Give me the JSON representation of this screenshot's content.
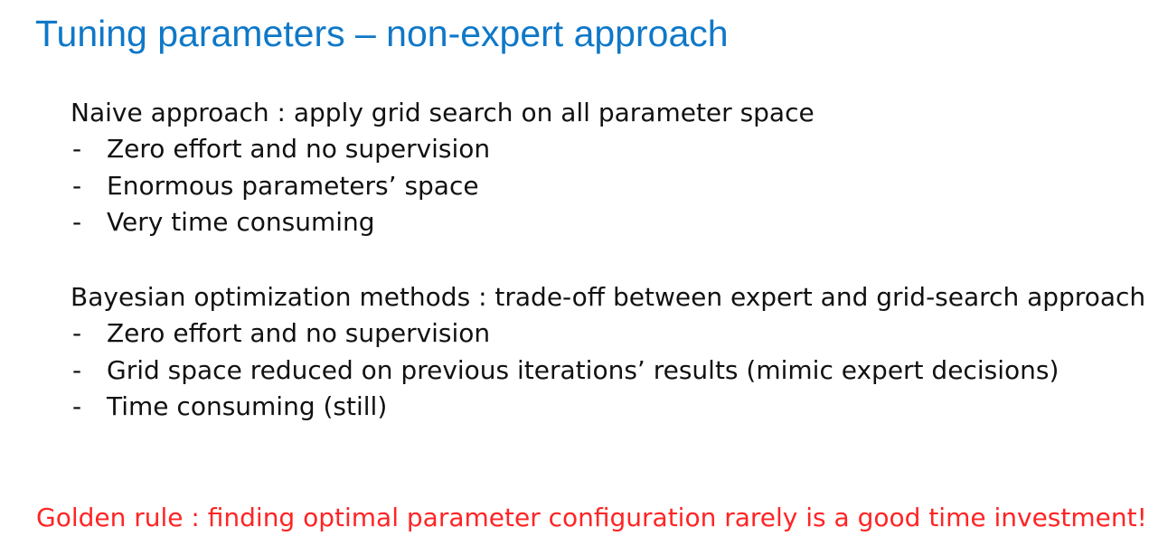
{
  "title": "Tuning parameters – non-expert approach",
  "sections": [
    {
      "heading": "Naive approach : apply grid search on all parameter space",
      "bullet_marker": "-",
      "bullets": [
        "Zero effort and no supervision",
        "Enormous parameters’ space",
        "Very time consuming"
      ]
    },
    {
      "heading": "Bayesian optimization methods : trade-off between expert and grid-search approach",
      "bullet_marker": "-",
      "bullets": [
        "Zero effort and no supervision",
        "Grid space reduced on previous iterations’ results (mimic expert decisions)",
        "Time consuming (still)"
      ]
    }
  ],
  "footer": {
    "golden_rule": "Golden rule : finding optimal parameter configuration rarely is a good time investment!"
  },
  "colors": {
    "title": "#0f78c8",
    "body": "#111111",
    "golden_rule": "#ff2424",
    "background": "#ffffff"
  }
}
